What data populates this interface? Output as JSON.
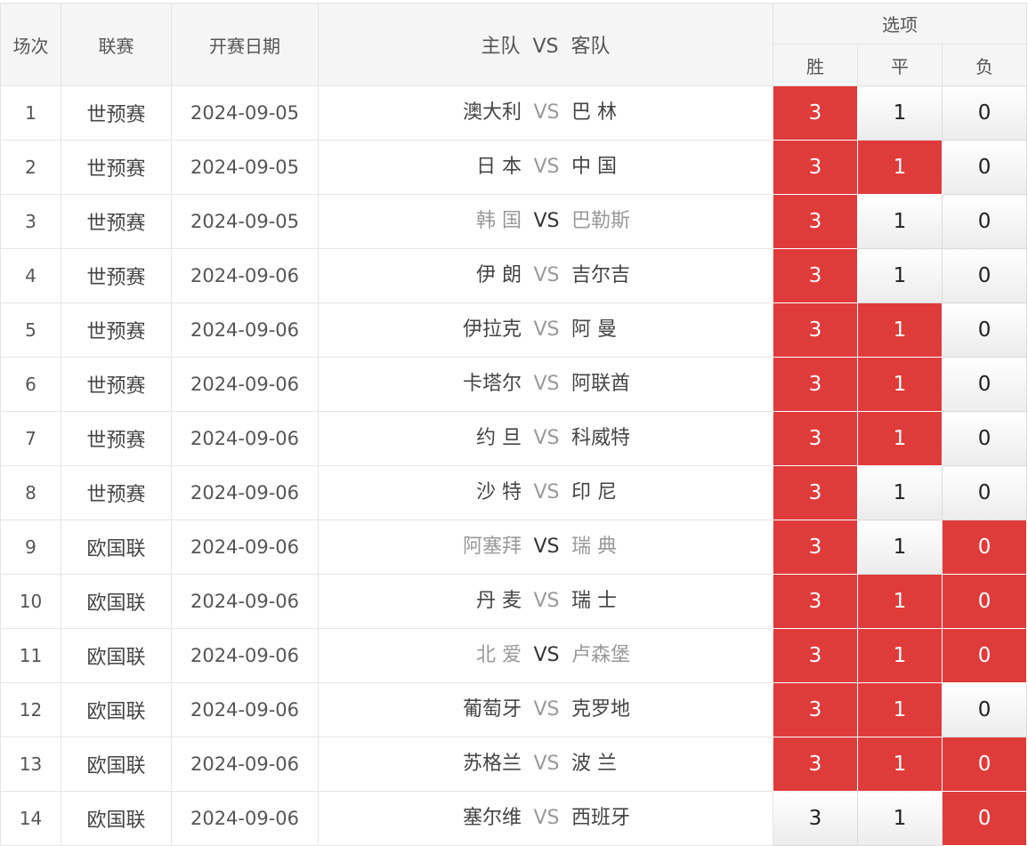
{
  "header": {
    "index": "场次",
    "league": "联赛",
    "date": "开赛日期",
    "home": "主队",
    "vs": "VS",
    "away": "客队",
    "options": "选项",
    "win": "胜",
    "draw": "平",
    "lose": "负"
  },
  "colors": {
    "selected": "#e03b3b",
    "dim_team": "#999999"
  },
  "rows": [
    {
      "index": "1",
      "league": "世预赛",
      "date": "2024-09-05",
      "home": "澳大利",
      "away": "巴 林",
      "vs": "VS",
      "home_dim": false,
      "away_dim": false,
      "win": "3",
      "draw": "1",
      "lose": "0",
      "sel": [
        true,
        false,
        false
      ]
    },
    {
      "index": "2",
      "league": "世预赛",
      "date": "2024-09-05",
      "home": "日 本",
      "away": "中 国",
      "vs": "VS",
      "home_dim": false,
      "away_dim": false,
      "win": "3",
      "draw": "1",
      "lose": "0",
      "sel": [
        true,
        true,
        false
      ]
    },
    {
      "index": "3",
      "league": "世预赛",
      "date": "2024-09-05",
      "home": "韩 国",
      "away": "巴勒斯",
      "vs": "VS",
      "home_dim": true,
      "away_dim": true,
      "win": "3",
      "draw": "1",
      "lose": "0",
      "sel": [
        true,
        false,
        false
      ]
    },
    {
      "index": "4",
      "league": "世预赛",
      "date": "2024-09-06",
      "home": "伊 朗",
      "away": "吉尔吉",
      "vs": "VS",
      "home_dim": false,
      "away_dim": false,
      "win": "3",
      "draw": "1",
      "lose": "0",
      "sel": [
        true,
        false,
        false
      ]
    },
    {
      "index": "5",
      "league": "世预赛",
      "date": "2024-09-06",
      "home": "伊拉克",
      "away": "阿 曼",
      "vs": "VS",
      "home_dim": false,
      "away_dim": false,
      "win": "3",
      "draw": "1",
      "lose": "0",
      "sel": [
        true,
        true,
        false
      ]
    },
    {
      "index": "6",
      "league": "世预赛",
      "date": "2024-09-06",
      "home": "卡塔尔",
      "away": "阿联酋",
      "vs": "VS",
      "home_dim": false,
      "away_dim": false,
      "win": "3",
      "draw": "1",
      "lose": "0",
      "sel": [
        true,
        true,
        false
      ]
    },
    {
      "index": "7",
      "league": "世预赛",
      "date": "2024-09-06",
      "home": "约 旦",
      "away": "科威特",
      "vs": "VS",
      "home_dim": false,
      "away_dim": false,
      "win": "3",
      "draw": "1",
      "lose": "0",
      "sel": [
        true,
        true,
        false
      ]
    },
    {
      "index": "8",
      "league": "世预赛",
      "date": "2024-09-06",
      "home": "沙 特",
      "away": "印 尼",
      "vs": "VS",
      "home_dim": false,
      "away_dim": false,
      "win": "3",
      "draw": "1",
      "lose": "0",
      "sel": [
        true,
        false,
        false
      ]
    },
    {
      "index": "9",
      "league": "欧国联",
      "date": "2024-09-06",
      "home": "阿塞拜",
      "away": "瑞 典",
      "vs": "VS",
      "home_dim": true,
      "away_dim": true,
      "win": "3",
      "draw": "1",
      "lose": "0",
      "sel": [
        true,
        false,
        true
      ]
    },
    {
      "index": "10",
      "league": "欧国联",
      "date": "2024-09-06",
      "home": "丹 麦",
      "away": "瑞 士",
      "vs": "VS",
      "home_dim": false,
      "away_dim": false,
      "win": "3",
      "draw": "1",
      "lose": "0",
      "sel": [
        true,
        true,
        true
      ]
    },
    {
      "index": "11",
      "league": "欧国联",
      "date": "2024-09-06",
      "home": "北 爱",
      "away": "卢森堡",
      "vs": "VS",
      "home_dim": true,
      "away_dim": true,
      "win": "3",
      "draw": "1",
      "lose": "0",
      "sel": [
        true,
        true,
        true
      ]
    },
    {
      "index": "12",
      "league": "欧国联",
      "date": "2024-09-06",
      "home": "葡萄牙",
      "away": "克罗地",
      "vs": "VS",
      "home_dim": false,
      "away_dim": false,
      "win": "3",
      "draw": "1",
      "lose": "0",
      "sel": [
        true,
        true,
        false
      ]
    },
    {
      "index": "13",
      "league": "欧国联",
      "date": "2024-09-06",
      "home": "苏格兰",
      "away": "波 兰",
      "vs": "VS",
      "home_dim": false,
      "away_dim": false,
      "win": "3",
      "draw": "1",
      "lose": "0",
      "sel": [
        true,
        true,
        true
      ]
    },
    {
      "index": "14",
      "league": "欧国联",
      "date": "2024-09-06",
      "home": "塞尔维",
      "away": "西班牙",
      "vs": "VS",
      "home_dim": false,
      "away_dim": false,
      "win": "3",
      "draw": "1",
      "lose": "0",
      "sel": [
        false,
        false,
        true
      ]
    }
  ]
}
